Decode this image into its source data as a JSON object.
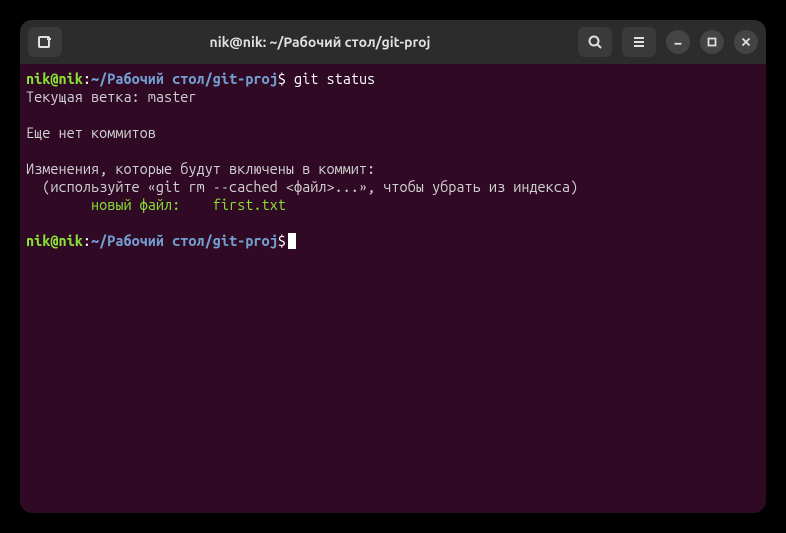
{
  "titlebar": {
    "title": "nik@nik: ~/Рабочий стол/git-proj"
  },
  "prompt1": {
    "user": "nik@nik",
    "colon": ":",
    "path": "~/Рабочий стол/git-proj",
    "dollar": "$",
    "command": " git status"
  },
  "output": {
    "line1": "Текущая ветка: master",
    "line2": "",
    "line3": "Еще нет коммитов",
    "line4": "",
    "line5": "Изменения, которые будут включены в коммит:",
    "line6": "  (используйте «git rm --cached <файл>...», чтобы убрать из индекса)",
    "line7_label": "        новый файл:    ",
    "line7_file": "first.txt",
    "line8": ""
  },
  "prompt2": {
    "user": "nik@nik",
    "colon": ":",
    "path": "~/Рабочий стол/git-proj",
    "dollar": "$"
  }
}
